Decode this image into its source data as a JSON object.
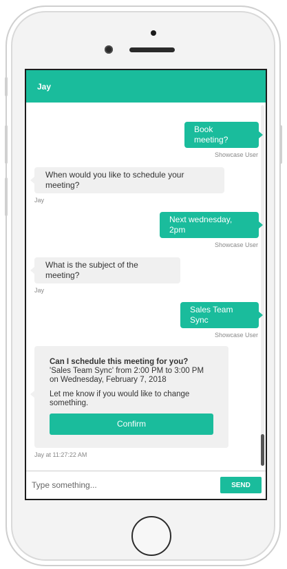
{
  "header": {
    "title": "Jay"
  },
  "messages": [
    {
      "sender": "user",
      "text": "Book meeting?",
      "meta": "Showcase User"
    },
    {
      "sender": "bot",
      "text": "When would you like to schedule your meeting?",
      "meta": "Jay"
    },
    {
      "sender": "user",
      "text": "Next wednesday, 2pm",
      "meta": "Showcase User"
    },
    {
      "sender": "bot",
      "text": "What is the subject of the meeting?",
      "meta": "Jay"
    },
    {
      "sender": "user",
      "text": "Sales Team Sync",
      "meta": "Showcase User"
    }
  ],
  "confirmation_card": {
    "title": "Can I schedule this meeting for you?",
    "details": "'Sales Team Sync' from 2:00 PM to 3:00 PM on Wednesday, February 7, 2018",
    "note": "Let me know if you would like to change something.",
    "confirm_label": "Confirm",
    "meta": "Jay at 11:27:22 AM"
  },
  "composer": {
    "placeholder": "Type something...",
    "send_label": "SEND"
  },
  "colors": {
    "accent": "#1abc9c",
    "bot_bubble": "#f0f0f0"
  }
}
